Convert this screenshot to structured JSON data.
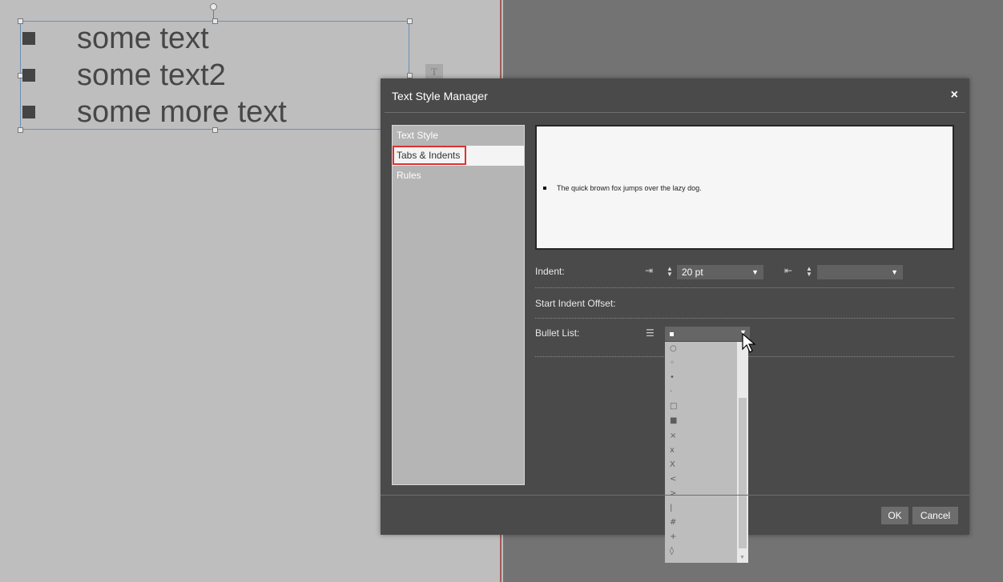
{
  "canvas": {
    "lines": [
      "some text",
      "some text2",
      "some more text"
    ],
    "text_edit_icon": "T"
  },
  "dialog": {
    "title": "Text Style Manager",
    "close_glyph": "×",
    "nav_items": [
      "Text Style",
      "Tabs & Indents",
      "Rules"
    ],
    "selected_nav": "Tabs & Indents",
    "preview_text": "The quick brown fox jumps over the lazy dog.",
    "indent_label": "Indent:",
    "indent_value": "20 pt",
    "indent_right_value": "",
    "start_indent_offset_label": "Start Indent Offset:",
    "bullet_list_label": "Bullet List:",
    "bullet_selected": "■",
    "bullet_options": [
      "○",
      "◦",
      "•",
      "·",
      "□",
      "■",
      "×",
      "x",
      "X",
      "<",
      ">",
      "|",
      "#",
      "+",
      "◊"
    ],
    "ok_label": "OK",
    "cancel_label": "Cancel"
  },
  "icons": {
    "indent_start": "indent-left-icon",
    "indent_end": "indent-right-icon",
    "list": "list-icon",
    "cursor": "mouse-pointer-icon"
  },
  "colors": {
    "highlight": "#e03030",
    "dialog_bg": "#4a4a4a",
    "preview_bg": "#f6f6f6"
  }
}
